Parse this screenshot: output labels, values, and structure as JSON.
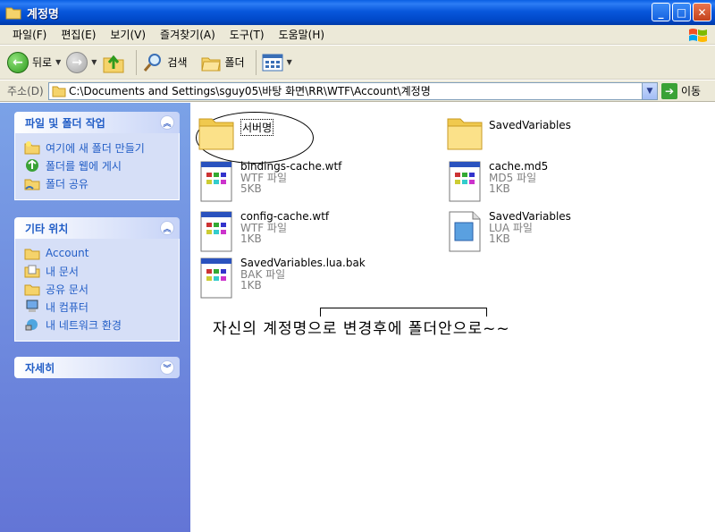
{
  "window": {
    "title": "계정명"
  },
  "menu": [
    "파일(F)",
    "편집(E)",
    "보기(V)",
    "즐겨찾기(A)",
    "도구(T)",
    "도움말(H)"
  ],
  "toolbar": {
    "back": "뒤로",
    "search": "검색",
    "folders": "폴더"
  },
  "address": {
    "label": "주소(D)",
    "path": "C:\\Documents and Settings\\sguy05\\바탕 화면\\RR\\WTF\\Account\\계정명",
    "go": "이동"
  },
  "side": {
    "tasks": {
      "title": "파일 및 폴더 작업",
      "items": [
        "여기에 새 폴더 만들기",
        "폴더를 웹에 게시",
        "폴더 공유"
      ]
    },
    "places": {
      "title": "기타 위치",
      "items": [
        "Account",
        "내 문서",
        "공유 문서",
        "내 컴퓨터",
        "내 네트워크 환경"
      ]
    },
    "details": {
      "title": "자세히"
    }
  },
  "files": [
    {
      "name": "서버명",
      "type": "",
      "size": "",
      "icon": "folder-icon"
    },
    {
      "name": "SavedVariables",
      "type": "",
      "size": "",
      "icon": "folder-icon"
    },
    {
      "name": "bindings-cache.wtf",
      "type": "WTF 파일",
      "size": "5KB",
      "icon": "document-icon"
    },
    {
      "name": "cache.md5",
      "type": "MD5 파일",
      "size": "1KB",
      "icon": "document-icon"
    },
    {
      "name": "config-cache.wtf",
      "type": "WTF 파일",
      "size": "1KB",
      "icon": "document-icon"
    },
    {
      "name": "SavedVariables",
      "type": "LUA 파일",
      "size": "1KB",
      "icon": "lua-file-icon"
    },
    {
      "name": "SavedVariables.lua.bak",
      "type": "BAK 파일",
      "size": "1KB",
      "icon": "document-icon"
    }
  ],
  "annotation": "자신의 계정명으로 변경후에 폴더안으로~~"
}
